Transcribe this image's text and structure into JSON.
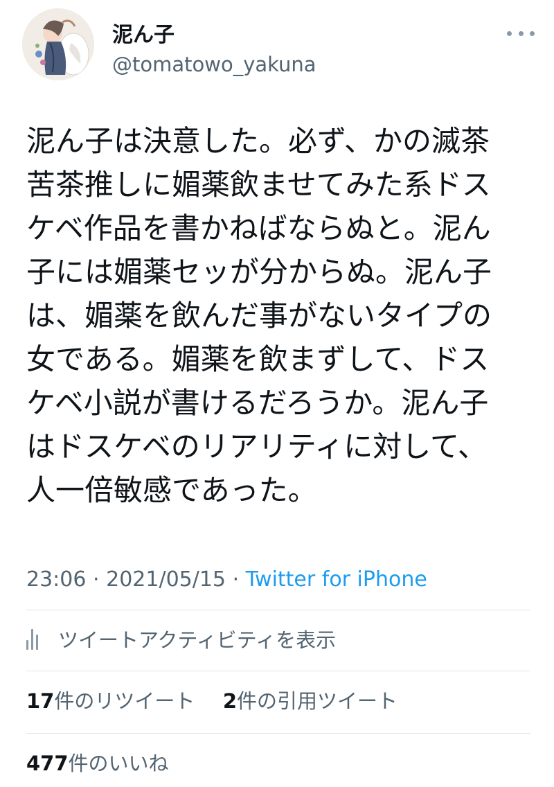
{
  "user": {
    "display_name": "泥ん子",
    "handle": "@tomatowo_yakuna"
  },
  "tweet": {
    "text": "泥ん子は決意した。必ず、かの滅茶\n苦茶推しに媚薬飲ませてみた系ドス\nケベ作品を書かねばならぬと。泥ん\n子には媚薬セッが分からぬ。泥ん子\nは、媚薬を飲んだ事がないタイプの\n女である。媚薬を飲まずして、ドス\nケベ小説が書けるだろうか。泥ん子\nはドスケベのリアリティに対して、\n人一倍敏感であった。",
    "time": "23:06",
    "date": "2021/05/15",
    "separator": "·",
    "source": "Twitter for iPhone"
  },
  "activity": {
    "label": "ツイートアクティビティを表示",
    "icon": "bar-chart-icon"
  },
  "stats": {
    "retweet_count": "17",
    "retweet_label": "件のリツイート",
    "quote_count": "2",
    "quote_label": "件の引用ツイート",
    "like_count": "477",
    "like_label": "件のいいね"
  },
  "colors": {
    "text": "#0f1419",
    "secondary": "#536471",
    "link": "#1d9bf0",
    "divider": "#dfe3e6"
  }
}
